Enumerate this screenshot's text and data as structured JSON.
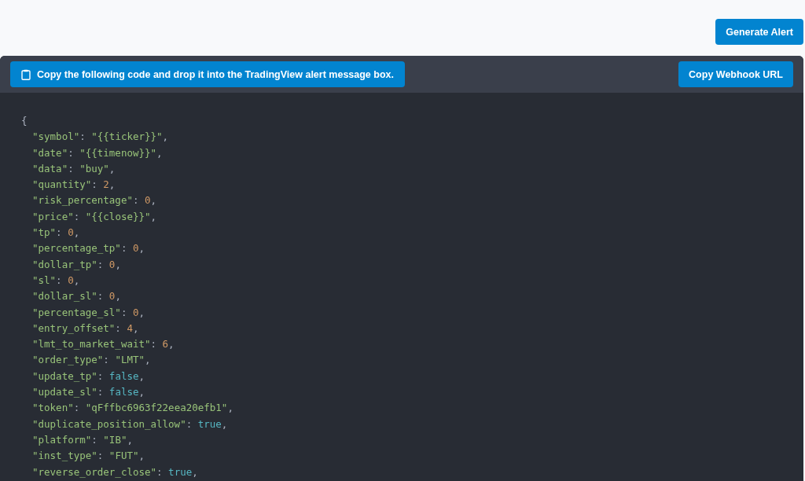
{
  "generate_button": "Generate Alert",
  "notice": "Copy the following code and drop it into the TradingView alert message box.",
  "copy_webhook_button": "Copy Webhook URL",
  "code_lines": [
    [
      {
        "kind": "punct",
        "text": "{"
      }
    ],
    [
      {
        "kind": "key",
        "text": "\"symbol\""
      },
      {
        "kind": "punct",
        "text": ": "
      },
      {
        "kind": "string",
        "text": "\"{{ticker}}\""
      },
      {
        "kind": "punct",
        "text": ","
      }
    ],
    [
      {
        "kind": "key",
        "text": "\"date\""
      },
      {
        "kind": "punct",
        "text": ": "
      },
      {
        "kind": "string",
        "text": "\"{{timenow}}\""
      },
      {
        "kind": "punct",
        "text": ","
      }
    ],
    [
      {
        "kind": "key",
        "text": "\"data\""
      },
      {
        "kind": "punct",
        "text": ": "
      },
      {
        "kind": "string",
        "text": "\"buy\""
      },
      {
        "kind": "punct",
        "text": ","
      }
    ],
    [
      {
        "kind": "key",
        "text": "\"quantity\""
      },
      {
        "kind": "punct",
        "text": ": "
      },
      {
        "kind": "number",
        "text": "2"
      },
      {
        "kind": "punct",
        "text": ","
      }
    ],
    [
      {
        "kind": "key",
        "text": "\"risk_percentage\""
      },
      {
        "kind": "punct",
        "text": ": "
      },
      {
        "kind": "number",
        "text": "0"
      },
      {
        "kind": "punct",
        "text": ","
      }
    ],
    [
      {
        "kind": "key",
        "text": "\"price\""
      },
      {
        "kind": "punct",
        "text": ": "
      },
      {
        "kind": "string",
        "text": "\"{{close}}\""
      },
      {
        "kind": "punct",
        "text": ","
      }
    ],
    [
      {
        "kind": "key",
        "text": "\"tp\""
      },
      {
        "kind": "punct",
        "text": ": "
      },
      {
        "kind": "number",
        "text": "0"
      },
      {
        "kind": "punct",
        "text": ","
      }
    ],
    [
      {
        "kind": "key",
        "text": "\"percentage_tp\""
      },
      {
        "kind": "punct",
        "text": ": "
      },
      {
        "kind": "number",
        "text": "0"
      },
      {
        "kind": "punct",
        "text": ","
      }
    ],
    [
      {
        "kind": "key",
        "text": "\"dollar_tp\""
      },
      {
        "kind": "punct",
        "text": ": "
      },
      {
        "kind": "number",
        "text": "0"
      },
      {
        "kind": "punct",
        "text": ","
      }
    ],
    [
      {
        "kind": "key",
        "text": "\"sl\""
      },
      {
        "kind": "punct",
        "text": ": "
      },
      {
        "kind": "number",
        "text": "0"
      },
      {
        "kind": "punct",
        "text": ","
      }
    ],
    [
      {
        "kind": "key",
        "text": "\"dollar_sl\""
      },
      {
        "kind": "punct",
        "text": ": "
      },
      {
        "kind": "number",
        "text": "0"
      },
      {
        "kind": "punct",
        "text": ","
      }
    ],
    [
      {
        "kind": "key",
        "text": "\"percentage_sl\""
      },
      {
        "kind": "punct",
        "text": ": "
      },
      {
        "kind": "number",
        "text": "0"
      },
      {
        "kind": "punct",
        "text": ","
      }
    ],
    [
      {
        "kind": "key",
        "text": "\"entry_offset\""
      },
      {
        "kind": "punct",
        "text": ": "
      },
      {
        "kind": "number",
        "text": "4"
      },
      {
        "kind": "punct",
        "text": ","
      }
    ],
    [
      {
        "kind": "key",
        "text": "\"lmt_to_market_wait\""
      },
      {
        "kind": "punct",
        "text": ": "
      },
      {
        "kind": "number",
        "text": "6"
      },
      {
        "kind": "punct",
        "text": ","
      }
    ],
    [
      {
        "kind": "key",
        "text": "\"order_type\""
      },
      {
        "kind": "punct",
        "text": ": "
      },
      {
        "kind": "string",
        "text": "\"LMT\""
      },
      {
        "kind": "punct",
        "text": ","
      }
    ],
    [
      {
        "kind": "key",
        "text": "\"update_tp\""
      },
      {
        "kind": "punct",
        "text": ": "
      },
      {
        "kind": "boolean",
        "text": "false"
      },
      {
        "kind": "punct",
        "text": ","
      }
    ],
    [
      {
        "kind": "key",
        "text": "\"update_sl\""
      },
      {
        "kind": "punct",
        "text": ": "
      },
      {
        "kind": "boolean",
        "text": "false"
      },
      {
        "kind": "punct",
        "text": ","
      }
    ],
    [
      {
        "kind": "key",
        "text": "\"token\""
      },
      {
        "kind": "punct",
        "text": ": "
      },
      {
        "kind": "string",
        "text": "\"qFffbc6963f22eea20efb1\""
      },
      {
        "kind": "punct",
        "text": ","
      }
    ],
    [
      {
        "kind": "key",
        "text": "\"duplicate_position_allow\""
      },
      {
        "kind": "punct",
        "text": ": "
      },
      {
        "kind": "boolean",
        "text": "true"
      },
      {
        "kind": "punct",
        "text": ","
      }
    ],
    [
      {
        "kind": "key",
        "text": "\"platform\""
      },
      {
        "kind": "punct",
        "text": ": "
      },
      {
        "kind": "string",
        "text": "\"IB\""
      },
      {
        "kind": "punct",
        "text": ","
      }
    ],
    [
      {
        "kind": "key",
        "text": "\"inst_type\""
      },
      {
        "kind": "punct",
        "text": ": "
      },
      {
        "kind": "string",
        "text": "\"FUT\""
      },
      {
        "kind": "punct",
        "text": ","
      }
    ],
    [
      {
        "kind": "key",
        "text": "\"reverse_order_close\""
      },
      {
        "kind": "punct",
        "text": ": "
      },
      {
        "kind": "boolean",
        "text": "true"
      },
      {
        "kind": "punct",
        "text": ","
      }
    ]
  ]
}
